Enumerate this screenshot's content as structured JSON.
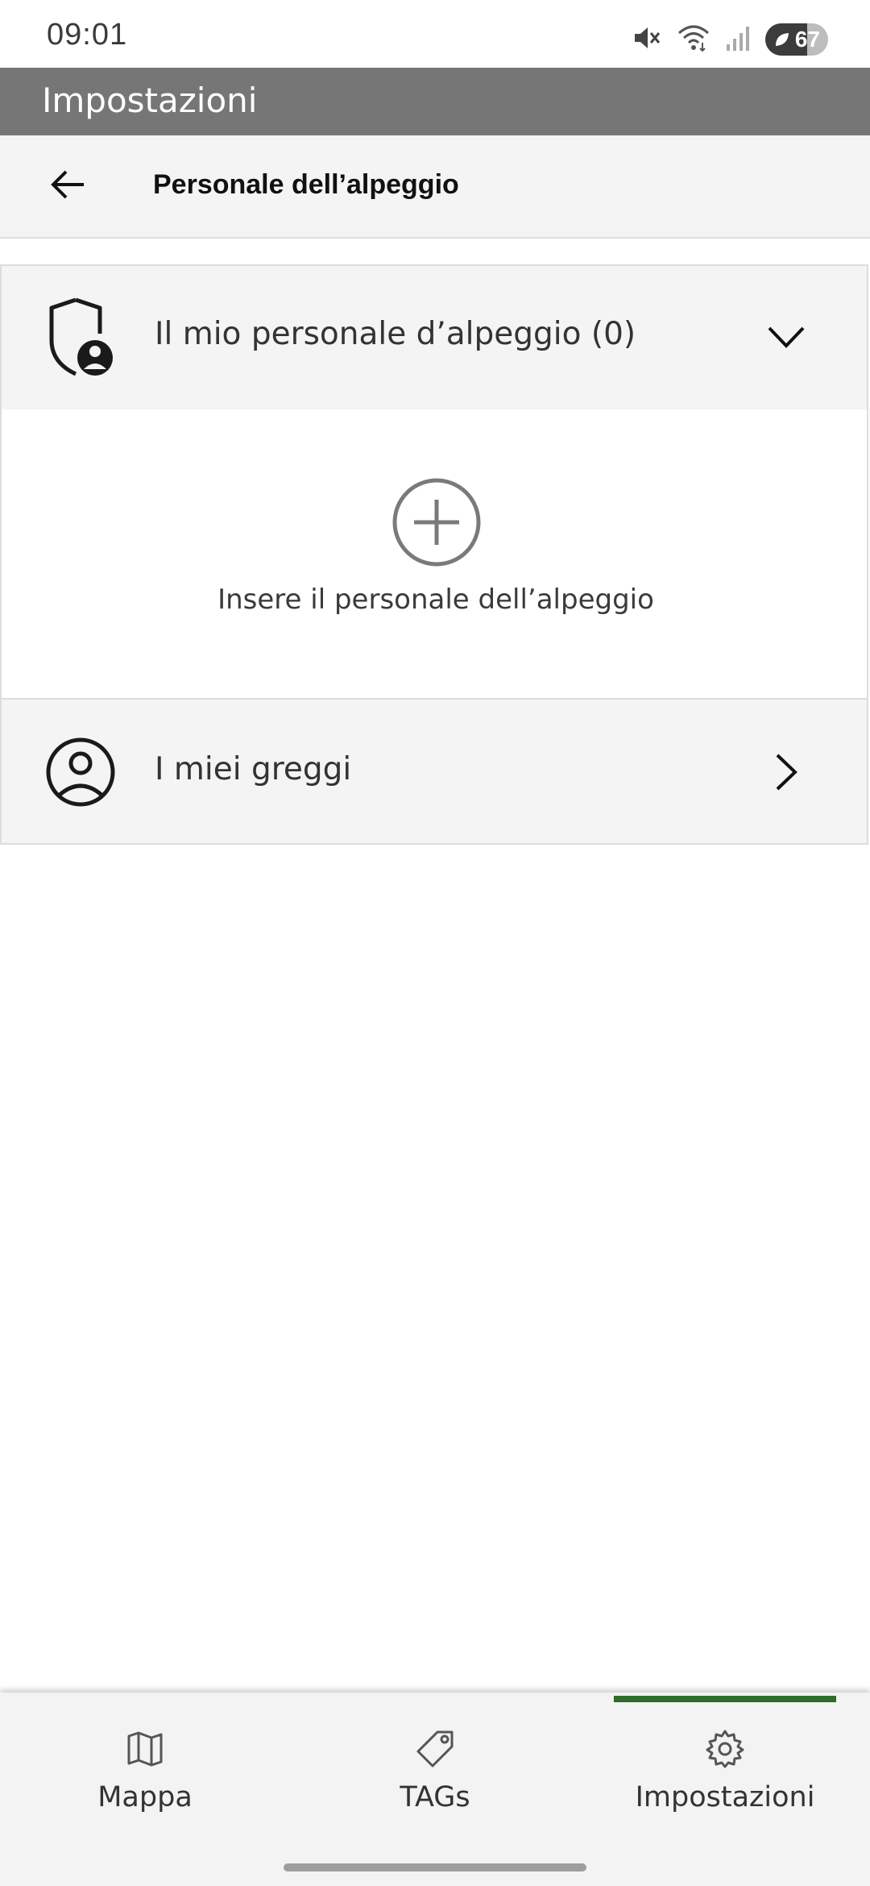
{
  "status_bar": {
    "time": "09:01",
    "battery_level": "67",
    "battery_fraction": 0.67,
    "icons": [
      "mute-icon",
      "wifi-icon",
      "signal-icon",
      "battery-icon"
    ]
  },
  "app_header": {
    "title": "Impostazioni"
  },
  "sub_header": {
    "title": "Personale dell’alpeggio",
    "back_icon": "arrow-left-icon"
  },
  "sections": {
    "staff": {
      "label": "Il mio personale d’alpeggio (0)",
      "icon": "shield-user-icon",
      "chevron": "chevron-down-icon",
      "add_label": "Insere il personale dell’alpeggio",
      "add_icon": "plus-circle-icon"
    },
    "flocks": {
      "label": "I miei greggi",
      "icon": "user-circle-icon",
      "chevron": "chevron-right-icon"
    }
  },
  "bottom_nav": {
    "items": [
      {
        "label": "Mappa",
        "icon": "map-icon"
      },
      {
        "label": "TAGs",
        "icon": "tag-icon"
      },
      {
        "label": "Impostazioni",
        "icon": "gear-icon"
      }
    ],
    "active_index": 2
  },
  "colors": {
    "header_bg": "#767676",
    "section_bg": "#f4f4f4",
    "nav_active": "#2f6b2b"
  }
}
